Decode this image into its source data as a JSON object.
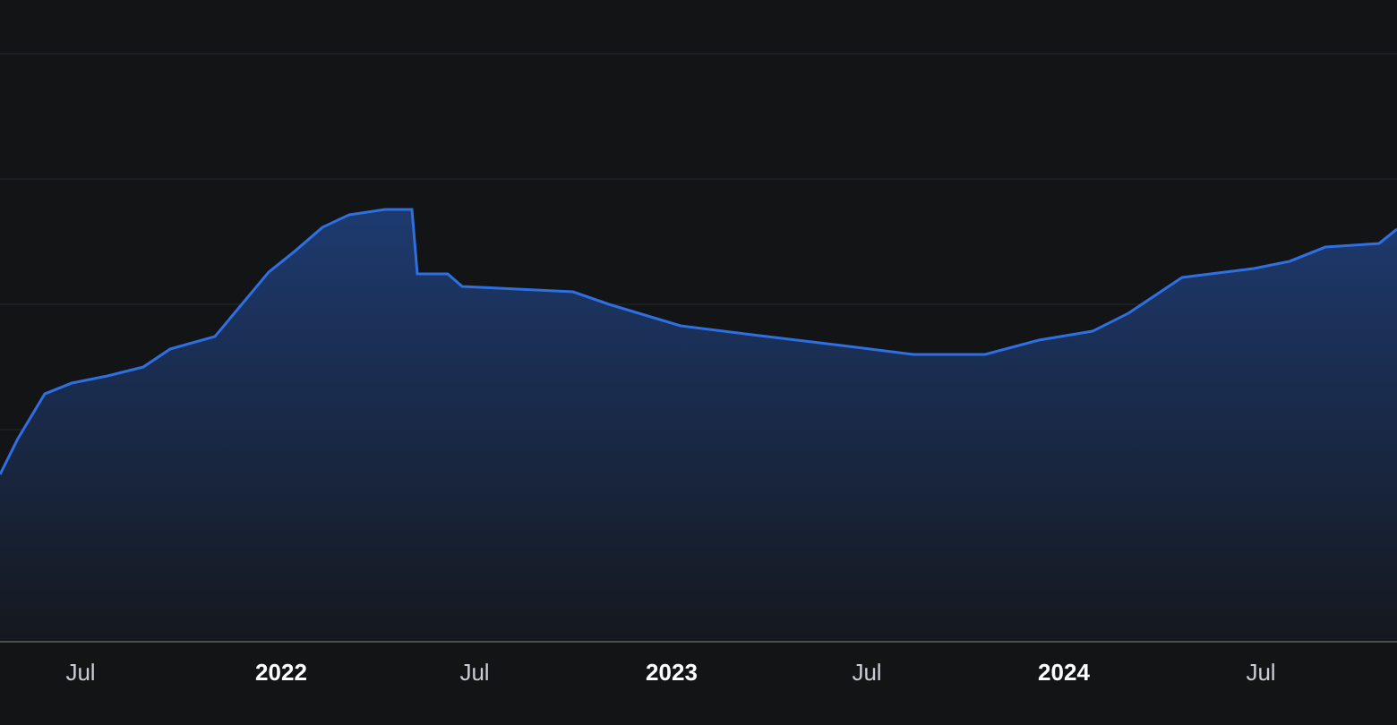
{
  "x_axis_labels": [
    {
      "label": "Jul",
      "kind": "month"
    },
    {
      "label": "2022",
      "kind": "year"
    },
    {
      "label": "Jul",
      "kind": "month"
    },
    {
      "label": "2023",
      "kind": "year"
    },
    {
      "label": "Jul",
      "kind": "month"
    },
    {
      "label": "2024",
      "kind": "year"
    },
    {
      "label": "Jul",
      "kind": "month"
    }
  ]
}
